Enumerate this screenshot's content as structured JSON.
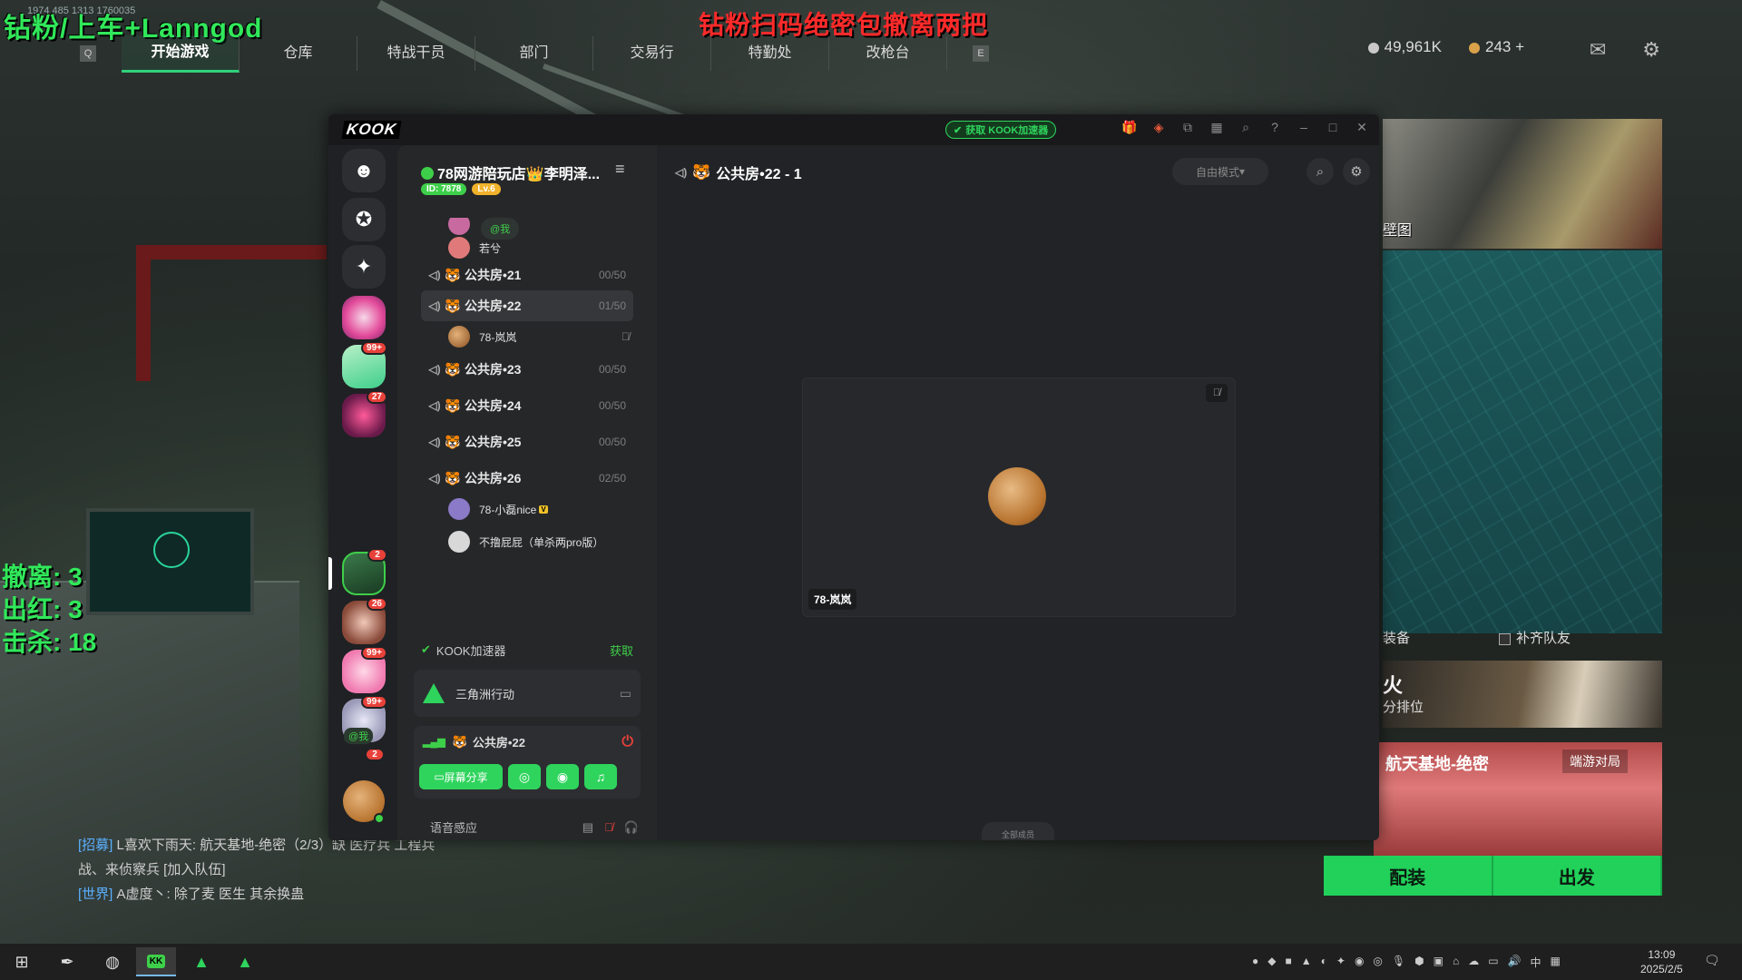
{
  "overlay": {
    "title": "钻粉/上车+Lanngod",
    "top_id": "1974 485 1313 1760035",
    "center": "钻粉扫码绝密包撤离两把",
    "stats": [
      "撤离: 3",
      "出红: 3",
      "击杀: 18"
    ]
  },
  "game": {
    "nav_key_left": "Q",
    "nav_key_right": "E",
    "nav": [
      "开始游戏",
      "仓库",
      "特战干员",
      "部门",
      "交易行",
      "特勤处",
      "改枪台"
    ],
    "silver": "49,961K",
    "gold": "243 +",
    "right_panel": {
      "img_label": "壁图",
      "equip": "装备",
      "fill_team": "补齐队友",
      "mode1_title": "火",
      "mode1_sub": "分排位",
      "mode2_title": "航天基地-绝密",
      "mode2_badge": "端游对局",
      "btn_loadout": "配装",
      "btn_go": "出发"
    },
    "chat": [
      {
        "tag": "[招募]",
        "text": " L喜欢下雨天: 航天基地-绝密（2/3）缺 医疗兵 工程兵"
      },
      {
        "tag": "",
        "text": "战、来侦察兵 [加入队伍]"
      },
      {
        "tag": "[世界]",
        "text": " A虚度丶: 除了麦 医生 其余换蛊"
      }
    ]
  },
  "kook": {
    "logo": "KOOK",
    "boost_badge": "获取 KOOK加速器",
    "server": {
      "name": "78网游陪玩店👑李明泽...",
      "id_tag": "ID: 7878",
      "level_tag": "Lv.6"
    },
    "rail_badges": [
      "99+",
      "27",
      "2",
      "26",
      "99+",
      "99+",
      "2"
    ],
    "rail_at_me": "@我",
    "channels": {
      "pre_member": "若兮",
      "at_pill": "@我",
      "items": [
        {
          "name": "公共房•21",
          "count": "00/50"
        },
        {
          "name": "公共房•22",
          "count": "01/50"
        },
        {
          "name": "公共房•23",
          "count": "00/50"
        },
        {
          "name": "公共房•24",
          "count": "00/50"
        },
        {
          "name": "公共房•25",
          "count": "00/50"
        },
        {
          "name": "公共房•26",
          "count": "02/50"
        }
      ],
      "member_22": "78-岚岚",
      "members_26": [
        "78-小磊nice",
        "不撸屁屁（单杀两pro版）"
      ]
    },
    "boost_row": {
      "label": "KOOK加速器",
      "action": "获取"
    },
    "game_card": "三角洲行动",
    "voice_card": {
      "channel": "公共房•22",
      "share": "屏幕分享"
    },
    "status_label": "语音感应",
    "main": {
      "title": "公共房•22 - 1",
      "mode": "自由模式",
      "tile_name": "78-岚岚",
      "members_btn": "全部成员"
    }
  },
  "taskbar": {
    "time": "13:09",
    "date": "2025/2/5",
    "ime": "中"
  }
}
